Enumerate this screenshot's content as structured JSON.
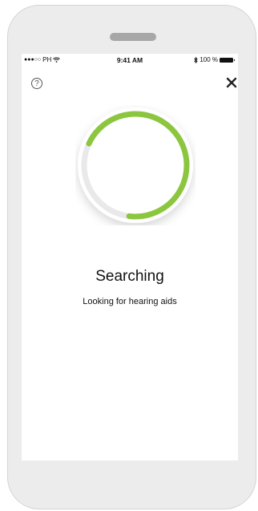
{
  "status_bar": {
    "carrier": "PH",
    "time": "9:41 AM",
    "battery": "100 %"
  },
  "icons": {
    "help": "help-icon",
    "close": "close-icon",
    "wifi": "wifi-icon",
    "bluetooth": "bluetooth-icon",
    "battery": "battery-icon"
  },
  "search": {
    "title": "Searching",
    "subtitle": "Looking for hearing aids",
    "progress_fraction": 0.7
  },
  "colors": {
    "accent": "#8cc63f",
    "track": "#e9e9e9",
    "frame": "#ececec"
  }
}
